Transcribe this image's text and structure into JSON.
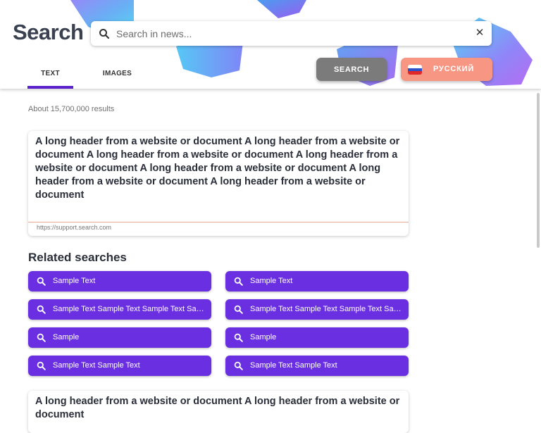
{
  "header": {
    "brand": "Search",
    "search": {
      "placeholder": "Search in news...",
      "value": ""
    },
    "clear_icon": "close-icon",
    "tabs": [
      {
        "label": "TEXT",
        "active": true
      },
      {
        "label": "IMAGES",
        "active": false
      }
    ],
    "search_button": "SEARCH",
    "language_button": {
      "label": "РУССКИЙ",
      "flag_icon": "russia-flag-icon"
    }
  },
  "results": {
    "count_text": "About 15,700,000 results",
    "items": [
      {
        "title": "A long header from a website or document A long header from a website or document A long header from a website or document A long header from a website or document A long header from a website or document A long header from a website or document A long header from a website or document",
        "url": "https://support.search.com"
      },
      {
        "title": "A long header from a website or document A long header from a website or document",
        "url": ""
      }
    ]
  },
  "related": {
    "title": "Related searches",
    "items": [
      "Sample Text",
      "Sample Text",
      "Sample Text Sample Text Sample Text Sample Text",
      "Sample Text Sample Text Sample Text Sample Text",
      "Sample",
      "Sample",
      "Sample Text Sample Text",
      "Sample Text Sample Text"
    ]
  },
  "colors": {
    "accent": "#5b21cc",
    "chip": "#6a2fe0",
    "search_button": "#7b7b7b",
    "language_button": "#f79683"
  }
}
